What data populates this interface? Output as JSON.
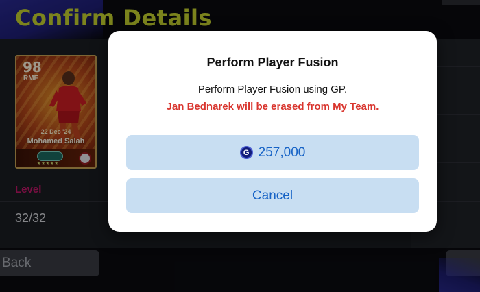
{
  "screen": {
    "title": "Confirm Details",
    "back_label": "Back"
  },
  "player_card": {
    "rating": "98",
    "position": "RMF",
    "date": "22 Dec '24",
    "name": "Mohamed Salah"
  },
  "details": {
    "level_label": "Level",
    "level_value": "32/32"
  },
  "dialog": {
    "title": "Perform Player Fusion",
    "message": "Perform Player Fusion using GP.",
    "warning": "Jan Bednarek will be erased from My Team.",
    "cost_icon": "G",
    "cost_label": "257,000",
    "cancel_label": "Cancel"
  },
  "colors": {
    "title_accent": "#c8d630",
    "level_label": "#c2186a",
    "warning": "#d9362f",
    "dialog_button_bg": "#c8def2",
    "dialog_button_text": "#1763c6"
  },
  "icons": {
    "gp_currency": "gp-coin-icon"
  }
}
